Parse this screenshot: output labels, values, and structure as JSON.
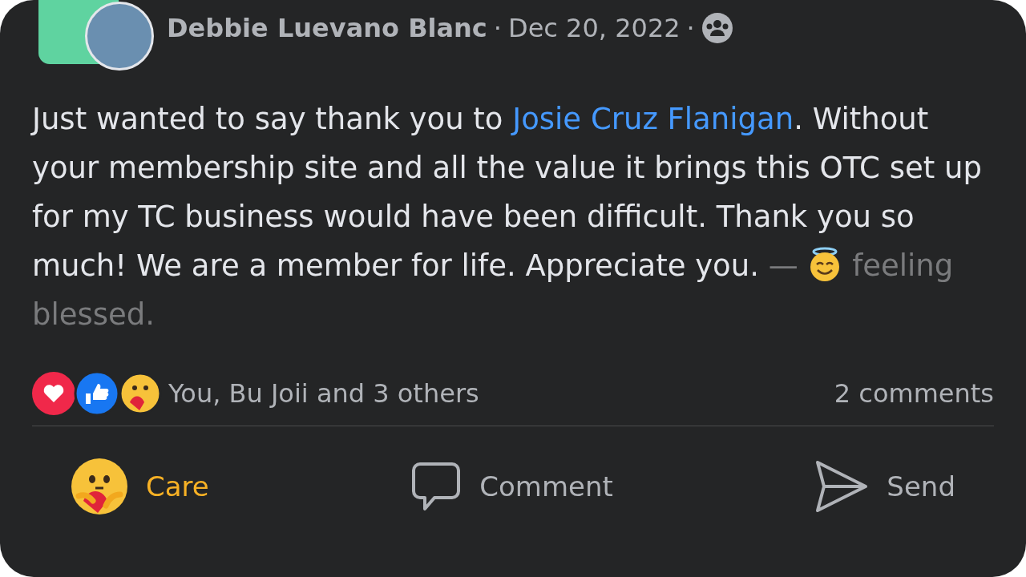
{
  "post": {
    "author": "Debbie Luevano Blanc",
    "separator_1": "·",
    "date": "Dec 20, 2022",
    "separator_2": "·",
    "body": {
      "text_before": "Just wanted to say thank you to ",
      "mention": "Josie Cruz Flanigan",
      "text_after": ". Without your membership site and all the value it brings this OTC set up for my TC business would have been difficult. Thank you so much! We are a member for life. Appreciate you.",
      "feeling_dash": "—",
      "feeling": "feeling blessed."
    },
    "reactions": {
      "summary": "You, Bu Joii and 3 others",
      "comments": "2 comments"
    },
    "actions": [
      {
        "kind": "care",
        "label": "Care",
        "selected": true
      },
      {
        "kind": "comment",
        "label": "Comment",
        "selected": false
      },
      {
        "kind": "send",
        "label": "Send",
        "selected": false
      }
    ]
  }
}
